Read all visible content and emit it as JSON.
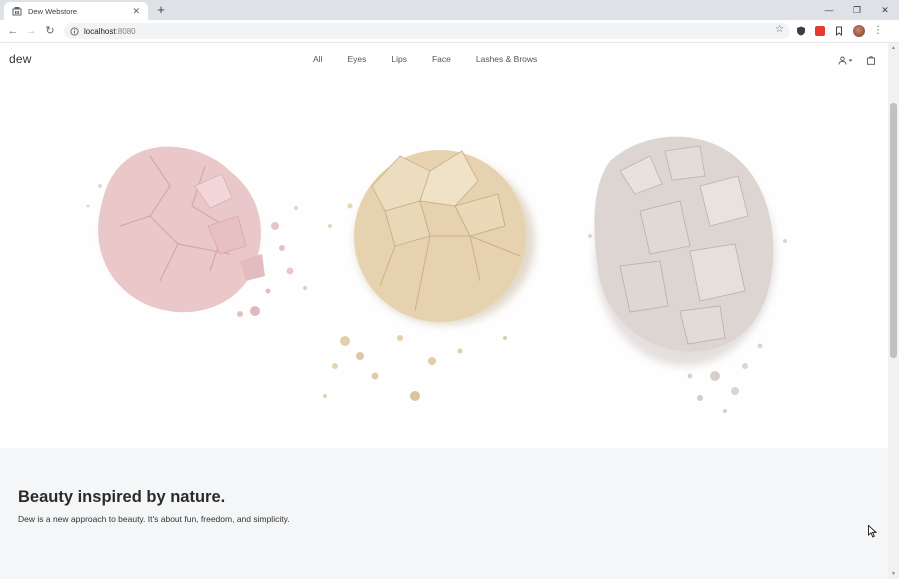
{
  "browser": {
    "tab_title": "Dew Webstore",
    "url_host": "localhost",
    "url_port": ":8080",
    "icons": [
      "back-icon",
      "forward-icon",
      "reload-icon",
      "info-icon",
      "star-icon",
      "extension-icons",
      "profile-avatar",
      "menu-icon"
    ]
  },
  "site": {
    "brand": "dew",
    "nav": [
      "All",
      "Eyes",
      "Lips",
      "Face",
      "Lashes & Brows"
    ],
    "header_icons": [
      "account-icon",
      "cart-icon"
    ]
  },
  "hero": {
    "image": "crushed-powder-compacts",
    "colors": [
      "#e8c4c6",
      "#e4cfab",
      "#d8d0cc"
    ]
  },
  "about": {
    "title": "Beauty inspired by nature.",
    "text": "Dew is a new approach to beauty. It's about fun, freedom, and simplicity."
  },
  "colors": {
    "page_bg": "#ffffff",
    "about_bg": "#f5f6f7",
    "tabstrip_bg": "#dee1e6"
  }
}
